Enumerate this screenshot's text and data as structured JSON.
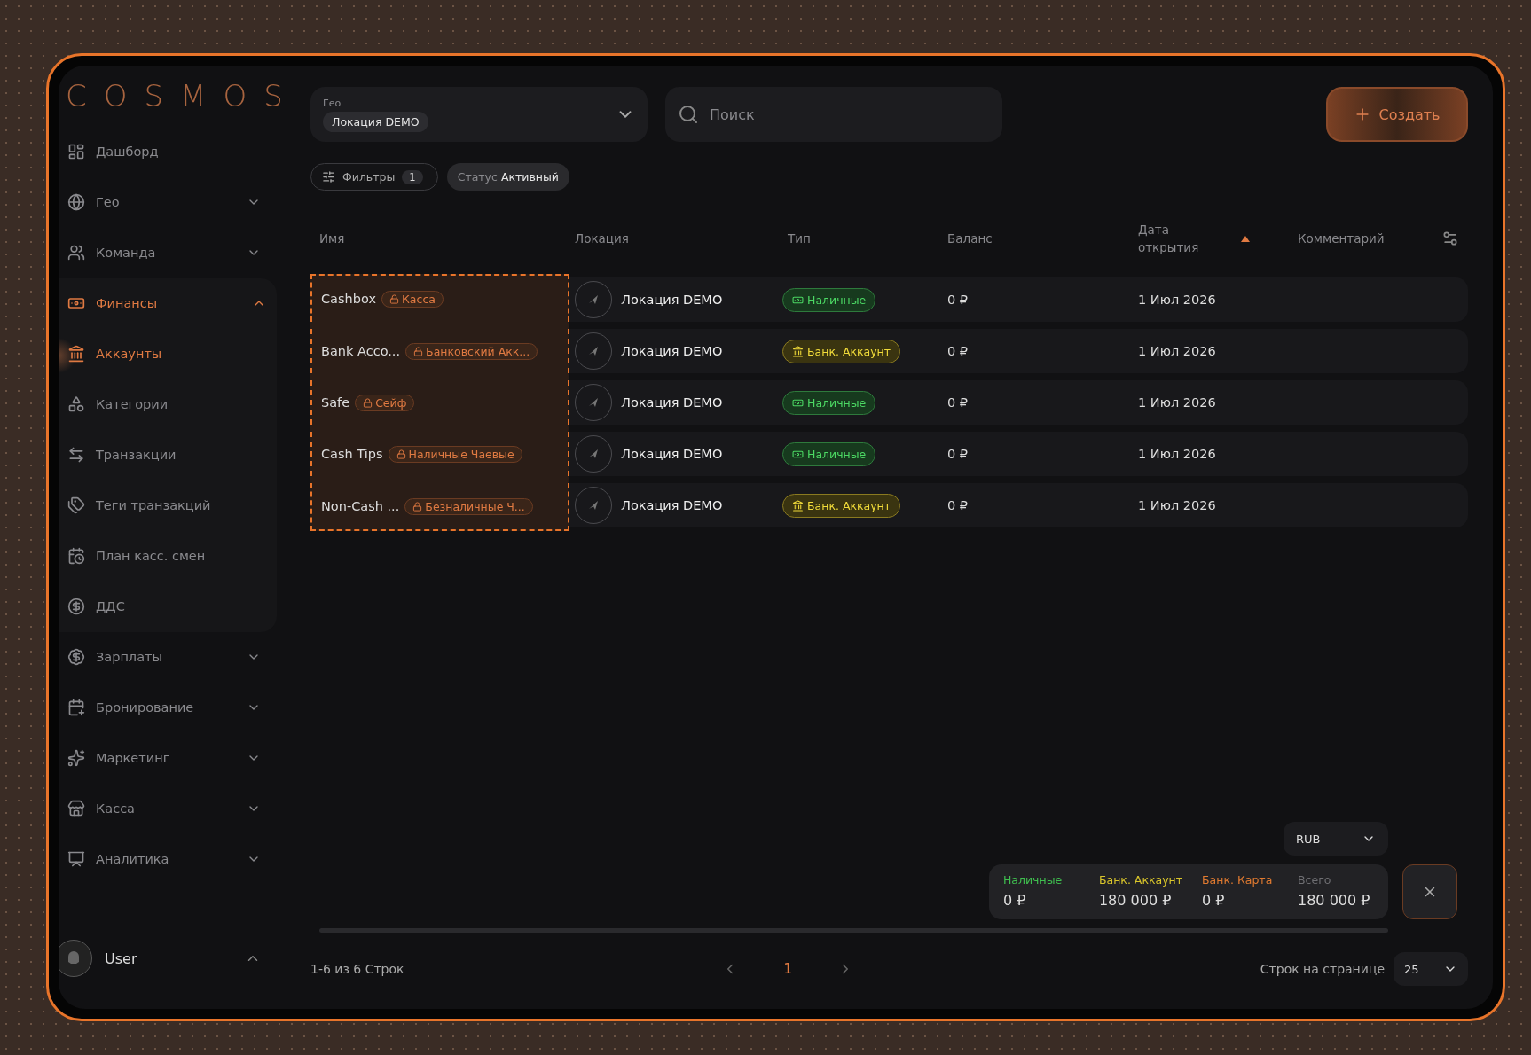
{
  "logo": "COSMOS",
  "sidebar": {
    "items": [
      {
        "label": "Дашборд",
        "kind": "link",
        "selected": false
      },
      {
        "label": "Гео",
        "kind": "group",
        "selected": false,
        "expanded": false
      },
      {
        "label": "Команда",
        "kind": "group",
        "selected": false,
        "expanded": false
      },
      {
        "label": "Финансы",
        "kind": "group",
        "selected": true,
        "expanded": true,
        "children": [
          {
            "label": "Аккаунты",
            "selected": true
          },
          {
            "label": "Категории",
            "selected": false
          },
          {
            "label": "Транзакции",
            "selected": false
          },
          {
            "label": "Теги транзакций",
            "selected": false
          },
          {
            "label": "План касс. смен",
            "selected": false
          },
          {
            "label": "ДДС",
            "selected": false
          }
        ]
      },
      {
        "label": "Зарплаты",
        "kind": "group",
        "selected": false,
        "expanded": false
      },
      {
        "label": "Бронирование",
        "kind": "group",
        "selected": false,
        "expanded": false
      },
      {
        "label": "Маркетинг",
        "kind": "group",
        "selected": false,
        "expanded": false
      },
      {
        "label": "Касса",
        "kind": "group",
        "selected": false,
        "expanded": false
      },
      {
        "label": "Аналитика",
        "kind": "group",
        "selected": false,
        "expanded": false
      }
    ],
    "user": {
      "name": "User",
      "expanded": true
    }
  },
  "geo": {
    "label": "Гео",
    "value": "Локация DEMO"
  },
  "search": {
    "placeholder": "Поиск"
  },
  "create_button": "Создать",
  "filters": {
    "label": "Фильтры",
    "count": "1"
  },
  "status_filter": {
    "label": "Статус",
    "value": "Активный"
  },
  "table": {
    "columns": [
      {
        "label": "Имя",
        "sorted": false
      },
      {
        "label": "Локация",
        "sorted": false
      },
      {
        "label": "Тип",
        "sorted": false
      },
      {
        "label": "Баланс",
        "sorted": false
      },
      {
        "label": "Дата открытия",
        "sorted": true
      },
      {
        "label": "Комментарий",
        "sorted": false
      }
    ],
    "rows": [
      {
        "selected": true,
        "name": "Cashbox",
        "tag": "Касса",
        "location": "Локация DEMO",
        "type": {
          "label": "Наличные",
          "kind": "cash"
        },
        "balance": "0 ₽",
        "date": "1 Июл 2026"
      },
      {
        "selected": true,
        "name": "Bank Acco...",
        "tag": "Банковский Акк...",
        "location": "Локация DEMO",
        "type": {
          "label": "Банк. Аккаунт",
          "kind": "bank"
        },
        "balance": "0 ₽",
        "date": "1 Июл 2026"
      },
      {
        "selected": true,
        "name": "Safe",
        "tag": "Сейф",
        "location": "Локация DEMO",
        "type": {
          "label": "Наличные",
          "kind": "cash"
        },
        "balance": "0 ₽",
        "date": "1 Июл 2026"
      },
      {
        "selected": true,
        "name": "Cash Tips",
        "tag": "Наличные Чаевые",
        "location": "Локация DEMO",
        "type": {
          "label": "Наличные",
          "kind": "cash"
        },
        "balance": "0 ₽",
        "date": "1 Июл 2026"
      },
      {
        "selected": true,
        "name": "Non-Cash ...",
        "tag": "Безналичные Ч...",
        "location": "Локация DEMO",
        "type": {
          "label": "Банк. Аккаунт",
          "kind": "bank"
        },
        "balance": "0 ₽",
        "date": "1 Июл 2026"
      }
    ]
  },
  "currency": "RUB",
  "summary": [
    {
      "label": "Наличные",
      "value": "0 ₽",
      "color": "#3fbf4f"
    },
    {
      "label": "Банк. Аккаунт",
      "value": "180 000 ₽",
      "color": "#d9c52b"
    },
    {
      "label": "Банк. Карта",
      "value": "0 ₽",
      "color": "#e07a30"
    },
    {
      "label": "Всего",
      "value": "180 000 ₽",
      "color": "#6e6e72"
    }
  ],
  "pagination": {
    "range": "1-6 из 6 Строк",
    "pages": [
      {
        "label": "1",
        "selected": true
      }
    ],
    "rows_label": "Строк на странице",
    "rows_value": "25"
  }
}
